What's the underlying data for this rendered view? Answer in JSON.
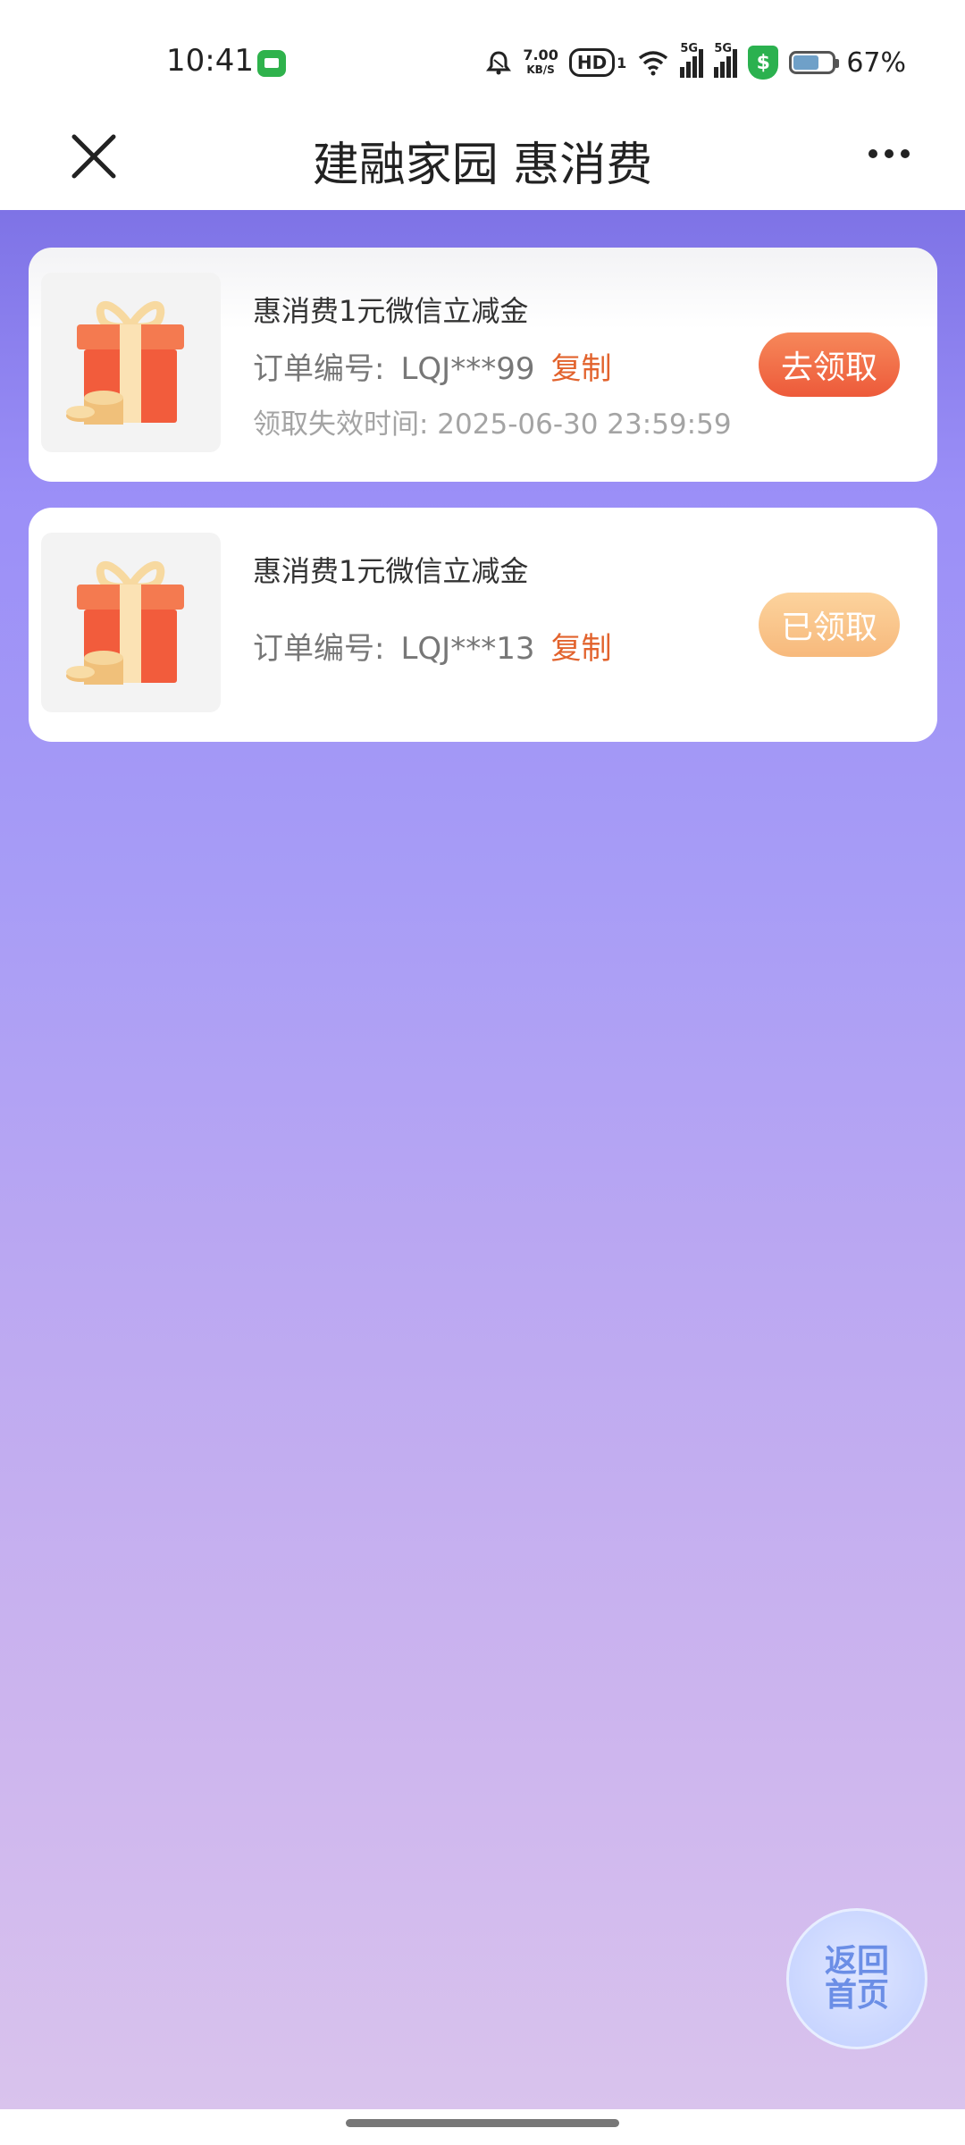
{
  "status_bar": {
    "time": "10:41",
    "net_speed_value": "7.00",
    "net_speed_unit": "KB/S",
    "hd_label": "HD",
    "hd_sub": "1",
    "sig1_label": "5G",
    "sig2_label": "5G",
    "shield_symbol": "$",
    "battery_percent": "67%",
    "battery_level": 0.67
  },
  "nav": {
    "title": "建融家园 惠消费"
  },
  "coupons": [
    {
      "title": "惠消费1元微信立减金",
      "order_label": "订单编号:",
      "order_no": "LQJ***99",
      "copy_label": "复制",
      "expire_text": "领取失效时间: 2025-06-30 23:59:59",
      "action_label": "去领取"
    },
    {
      "title": "惠消费1元微信立减金",
      "order_label": "订单编号:",
      "order_no": "LQJ***13",
      "copy_label": "复制",
      "action_label": "已领取"
    }
  ],
  "float_button": {
    "line1": "返回",
    "line2": "首页"
  },
  "colors": {
    "accent_orange": "#e2632d",
    "claim_button": "#ed5a3a",
    "claimed_button": "#f7b97c",
    "background_top": "#7e73e6",
    "background_bottom": "#d9c3ed"
  }
}
